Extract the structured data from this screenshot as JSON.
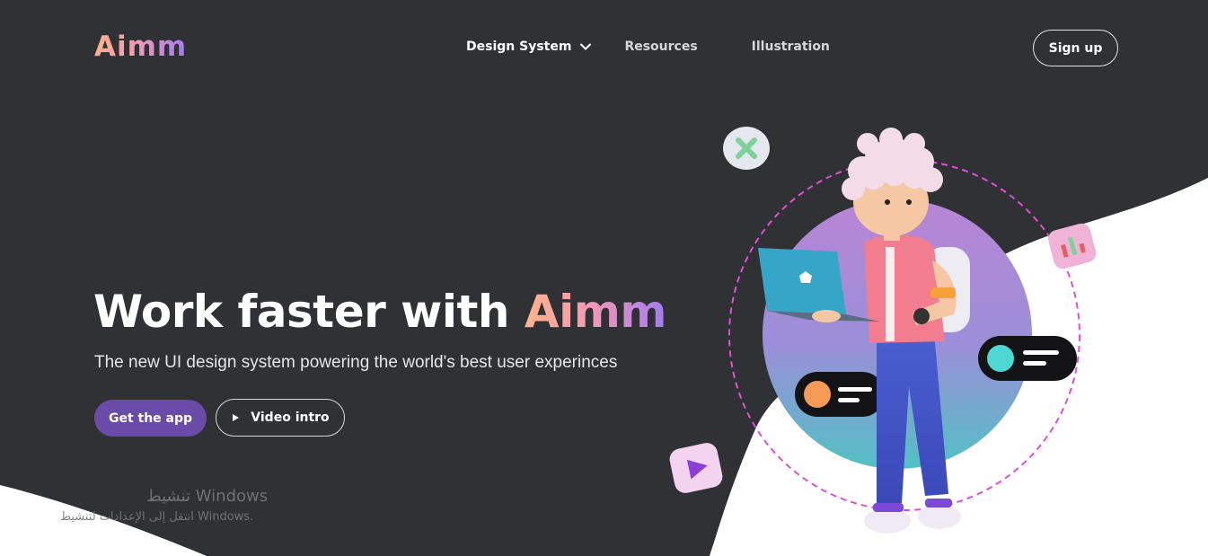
{
  "header": {
    "logo": "Aimm",
    "nav": [
      {
        "label": "Design System"
      },
      {
        "label": "Resources"
      },
      {
        "label": "Illustration"
      }
    ],
    "signup_label": "Sign up"
  },
  "hero": {
    "title_prefix": "Work faster with ",
    "title_brand": "Aimm",
    "subtitle": "The new UI design system powering the world's best user experinces",
    "primary_button": "Get the app",
    "secondary_button": "Video intro"
  },
  "watermark": {
    "title": "تنشيط Windows",
    "subtitle": "انتقل إلى الإعدادات لتنشيط Windows."
  },
  "colors": {
    "background": "#2f3135",
    "accent": "#6a4ba8",
    "brand_gradient_start": "#ffb38a",
    "brand_gradient_end": "#a17bf0"
  },
  "icons": {
    "nav_dropdown": "chevron-down-icon",
    "video": "play-icon"
  }
}
